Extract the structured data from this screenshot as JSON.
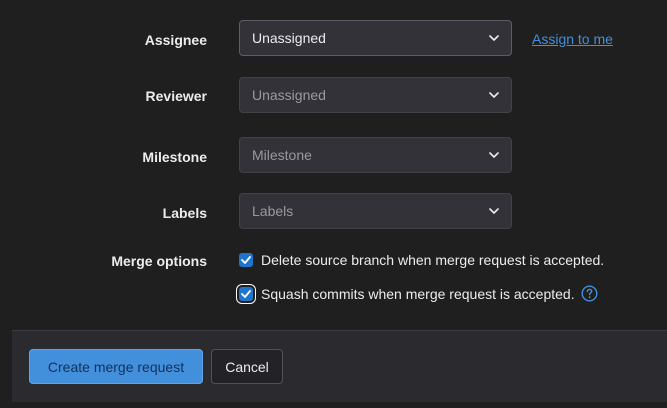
{
  "fields": {
    "assignee": {
      "label": "Assignee",
      "value": "Unassigned",
      "link": "Assign to me"
    },
    "reviewer": {
      "label": "Reviewer",
      "value": "Unassigned"
    },
    "milestone": {
      "label": "Milestone",
      "value": "Milestone"
    },
    "labels": {
      "label": "Labels",
      "value": "Labels"
    }
  },
  "merge_options": {
    "label": "Merge options",
    "options": [
      {
        "text": "Delete source branch when merge request is accepted.",
        "checked": true
      },
      {
        "text": "Squash commits when merge request is accepted.",
        "checked": true
      }
    ]
  },
  "footer": {
    "create_label": "Create merge request",
    "cancel_label": "Cancel"
  },
  "icons": {
    "dropdown": "chevron-down-icon",
    "check": "check-icon",
    "help": "question-circle-icon"
  },
  "colors": {
    "accent": "#428fdc",
    "checkbox": "#1f75cb",
    "background": "#1f1f1f",
    "footer": "#2b2b2f"
  }
}
